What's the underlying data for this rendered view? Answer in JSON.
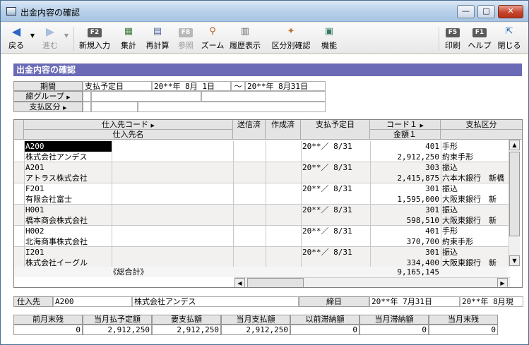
{
  "window": {
    "title": "出金内容の確認",
    "buttons": {
      "minimize": "—",
      "maximize": "□",
      "close": "✕"
    }
  },
  "toolbar": {
    "back": {
      "label": "戻る",
      "icon": "arrow-left-icon"
    },
    "forward": {
      "label": "進む",
      "icon": "arrow-right-icon"
    },
    "new_entry": {
      "label": "新規入力",
      "key": "F2"
    },
    "total": {
      "label": "集計"
    },
    "recalc": {
      "label": "再計算"
    },
    "reference": {
      "label": "参照",
      "key": "F8"
    },
    "zoom": {
      "label": "ズーム"
    },
    "history": {
      "label": "履歴表示"
    },
    "category_check": {
      "label": "区分別確認"
    },
    "function": {
      "label": "機能"
    },
    "print": {
      "label": "印刷",
      "key": "F5"
    },
    "help": {
      "label": "ヘルプ",
      "key": "F1"
    },
    "close": {
      "label": "閉じる"
    }
  },
  "section_title": "出金内容の確認",
  "conditions": {
    "period_label": "期間",
    "period_type": "支払予定日",
    "period_from": "20**年 8月 1日",
    "period_sep": "～",
    "period_to": "20**年 8月31日",
    "group_label": "締グループ",
    "category_label": "支払区分"
  },
  "grid": {
    "headers": {
      "supplier_code": "仕入先コード",
      "supplier_name": "仕入先名",
      "sent": "送信済",
      "created": "作成済",
      "due_date": "支払予定日",
      "code1": "コード１",
      "amount1": "金額１",
      "category": "支払区分"
    },
    "rows": [
      {
        "code": "A200",
        "name": "株式会社アンデス",
        "date": "20**／ 8/31",
        "code1": "401",
        "amount": "2,912,250",
        "cat1": "手形",
        "cat2": "約束手形"
      },
      {
        "code": "A201",
        "name": "アトラス株式会社",
        "date": "20**／ 8/31",
        "code1": "303",
        "amount": "2,415,875",
        "cat1": "振込",
        "cat2": "六本木銀行　新橋"
      },
      {
        "code": "F201",
        "name": "有限会社富士",
        "date": "20**／ 8/31",
        "code1": "301",
        "amount": "1,595,000",
        "cat1": "振込",
        "cat2": "大阪東銀行　新"
      },
      {
        "code": "H001",
        "name": "橋本商会株式会社",
        "date": "20**／ 8/31",
        "code1": "301",
        "amount": "598,510",
        "cat1": "振込",
        "cat2": "大阪東銀行　新"
      },
      {
        "code": "H002",
        "name": "北海商事株式会社",
        "date": "20**／ 8/31",
        "code1": "401",
        "amount": "370,700",
        "cat1": "手形",
        "cat2": "約束手形"
      },
      {
        "code": "I201",
        "name": "株式会社イーグル",
        "date": "20**／ 8/31",
        "code1": "301",
        "amount": "334,400",
        "cat1": "振込",
        "cat2": "大阪東銀行　新"
      }
    ],
    "total_label": "《総合計》",
    "total_amount": "9,165,145"
  },
  "footer": {
    "supplier_label": "仕入先",
    "supplier_code": "A200",
    "supplier_name": "株式会社アンデス",
    "closing_label": "締日",
    "closing_date": "20**年 7月31日",
    "closing_date2": "20**年 8月現"
  },
  "summary": {
    "headers": [
      "前月末残",
      "当月払予定額",
      "要支払額",
      "当月支払額",
      "以前滞納額",
      "当月滞納額",
      "当月末残"
    ],
    "values": [
      "0",
      "2,912,250",
      "2,912,250",
      "2,912,250",
      "0",
      "0",
      "0"
    ]
  }
}
